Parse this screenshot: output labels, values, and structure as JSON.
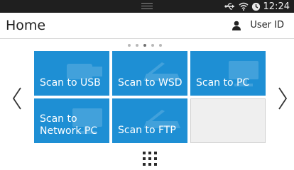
{
  "statusbar": {
    "time": "12:24",
    "icons": [
      "menu-lines-icon",
      "usb-icon",
      "wifi-icon",
      "clock-icon"
    ]
  },
  "header": {
    "title": "Home",
    "user_label": "User ID",
    "user_icon": "user-icon"
  },
  "pager": {
    "page_count": 5,
    "active_index": 2
  },
  "tiles": [
    {
      "label": "Scan to USB",
      "icon": "usb-drive-icon"
    },
    {
      "label": "Scan to WSD",
      "icon": "scanner-icon"
    },
    {
      "label": "Scan to PC",
      "icon": "computer-icon"
    },
    {
      "label": "Scan to\nNetwork PC",
      "icon": "network-pc-icon"
    },
    {
      "label": "Scan to FTP",
      "icon": "scanner-icon"
    }
  ],
  "navigation": {
    "prev_icon": "chevron-left-icon",
    "next_icon": "chevron-right-icon",
    "apps_icon": "apps-grid-icon"
  },
  "colors": {
    "tile": "#1e8fd4",
    "statusbar": "#1f1f1f",
    "empty_tile": "#efefef"
  }
}
